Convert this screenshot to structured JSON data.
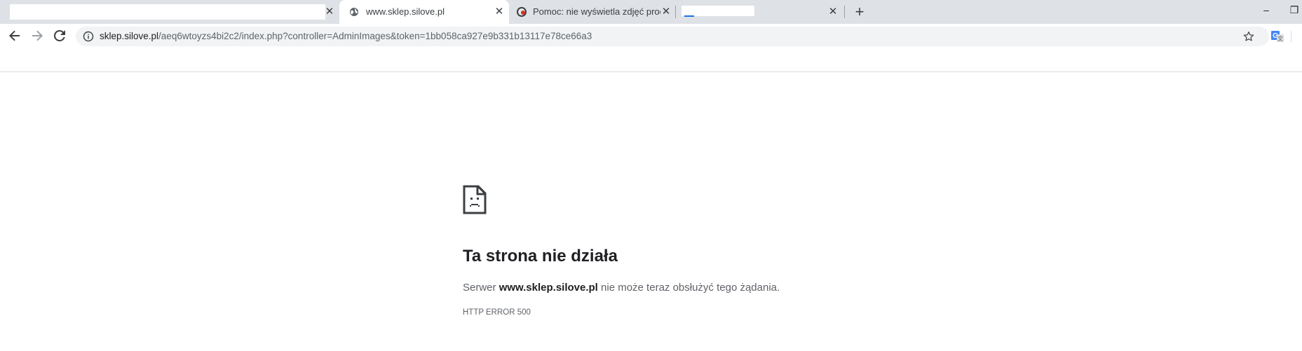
{
  "tabs": [
    {
      "title": "",
      "active": false
    },
    {
      "title": "www.sklep.silove.pl",
      "active": true
    },
    {
      "title": "Pomoc: nie wyświetla zdjęć produ",
      "active": false
    },
    {
      "title": "",
      "active": false
    }
  ],
  "new_tab_label": "+",
  "window": {
    "minimize": "–",
    "restore": "❐"
  },
  "address_bar": {
    "host": "sklep.silove.pl",
    "path": "/aeq6wtoyzs4bi2c2/index.php?controller=AdminImages&token=1bb058ca927e9b331b13117e78ce66a3"
  },
  "error": {
    "title": "Ta strona nie działa",
    "body_prefix": "Serwer ",
    "body_host": "www.sklep.silove.pl",
    "body_suffix": " nie może teraz obsłużyć tego żądania.",
    "code": "HTTP ERROR 500"
  },
  "colors": {
    "tabstrip_bg": "#dee1e6",
    "omnibox_bg": "#f1f3f4",
    "text_primary": "#202124",
    "text_secondary": "#5f6368"
  },
  "icons": [
    "globe-icon",
    "pomoc-favicon-icon",
    "close-icon",
    "plus-icon",
    "back-arrow-icon",
    "forward-arrow-icon",
    "reload-icon",
    "info-icon",
    "star-icon",
    "translate-icon",
    "sad-page-icon"
  ]
}
